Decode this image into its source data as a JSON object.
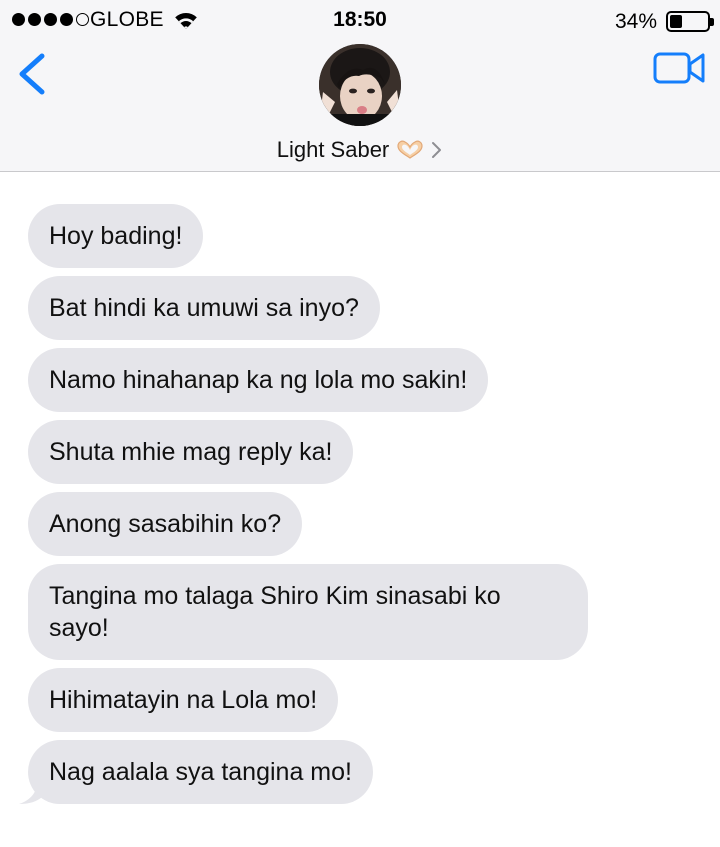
{
  "status_bar": {
    "carrier": "GLOBE",
    "time": "18:50",
    "battery_percent": "34%",
    "battery_level": 0.34,
    "signal_bars_filled": 4,
    "signal_bars_total": 5
  },
  "nav": {
    "back_icon": "chevron-left-icon",
    "video_icon": "video-camera-icon",
    "accent_color": "#147efb"
  },
  "contact": {
    "name": "Light Saber",
    "emoji": "🫶🏼"
  },
  "messages": [
    {
      "text": "Hoy bading!"
    },
    {
      "text": "Bat hindi ka umuwi sa inyo?"
    },
    {
      "text": "Namo hinahanap ka ng lola mo sakin!"
    },
    {
      "text": "Shuta mhie mag reply ka!"
    },
    {
      "text": "Anong sasabihin ko?"
    },
    {
      "text": "Tangina mo talaga Shiro Kim sinasabi ko sayo!"
    },
    {
      "text": "Hihimatayin na Lola mo!"
    },
    {
      "text": "Nag aalala sya tangina mo!"
    }
  ],
  "colors": {
    "incoming_bubble": "#e5e5ea",
    "header_bg": "#f6f6f8"
  }
}
